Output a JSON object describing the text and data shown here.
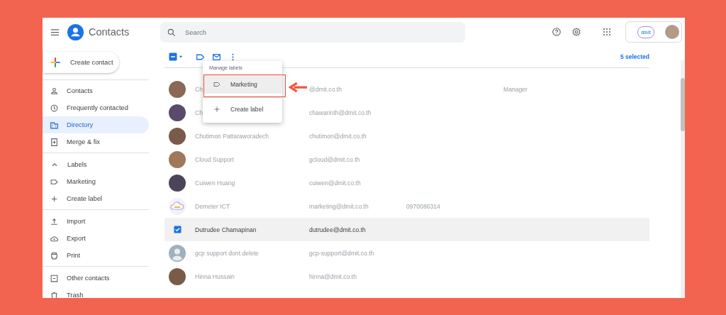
{
  "header": {
    "app_title": "Contacts",
    "search": {
      "placeholder": "Search"
    },
    "org_logo_text": "dmit"
  },
  "sidebar": {
    "create_button": "Create contact",
    "sections": [
      {
        "items": [
          {
            "label": "Contacts",
            "selected": false
          },
          {
            "label": "Frequently contacted",
            "selected": false
          },
          {
            "label": "Directory",
            "selected": true
          },
          {
            "label": "Merge & fix",
            "selected": false
          }
        ]
      },
      {
        "heading": {
          "label": "Labels",
          "expanded": true
        },
        "items": [
          {
            "label": "Marketing",
            "selected": false
          },
          {
            "label": "Create label",
            "selected": false
          }
        ]
      },
      {
        "items": [
          {
            "label": "Import",
            "selected": false
          },
          {
            "label": "Export",
            "selected": false
          },
          {
            "label": "Print",
            "selected": false
          }
        ]
      },
      {
        "items": [
          {
            "label": "Other contacts",
            "selected": false
          },
          {
            "label": "Trash",
            "selected": false
          }
        ]
      }
    ]
  },
  "toolbar": {
    "selection_count": "5 selected"
  },
  "label_menu": {
    "heading": "Manage labels",
    "items": [
      {
        "kind": "label",
        "label": "Marketing",
        "selected": true
      },
      {
        "kind": "create",
        "label": "Create label",
        "selected": false
      }
    ]
  },
  "contacts": [
    {
      "kind": "photo",
      "name": "Ch",
      "email": "@dmit.co.th",
      "job_title": "Manager",
      "selected": false
    },
    {
      "kind": "photo",
      "name": "Ch",
      "email": "chawarinth@dmit.co.th",
      "selected": false
    },
    {
      "kind": "photo",
      "name": "Chutimon Pattaraworadech",
      "email": "chutimon@dmit.co.th",
      "selected": false
    },
    {
      "kind": "photo",
      "name": "Cloud Support",
      "email": "gcloud@dmit.co.th",
      "selected": false
    },
    {
      "kind": "photo",
      "name": "Cuiwen Huang",
      "email": "cuiwen@dmit.co.th",
      "selected": false
    },
    {
      "kind": "logo",
      "name": "Demeter ICT",
      "email": "marketing@dmit.co.th",
      "phone": "0970086314",
      "selected": false
    },
    {
      "name": "Dutrudee Chamapinan",
      "email": "dutrudee@dmit.co.th",
      "selected": true
    },
    {
      "kind": "person",
      "name": "gcp support dont delete",
      "email": "gcp-support@dmit.co.th",
      "selected": false
    },
    {
      "kind": "photo",
      "name": "Hinna Hussain",
      "email": "hinna@dmit.co.th",
      "selected": false
    }
  ]
}
